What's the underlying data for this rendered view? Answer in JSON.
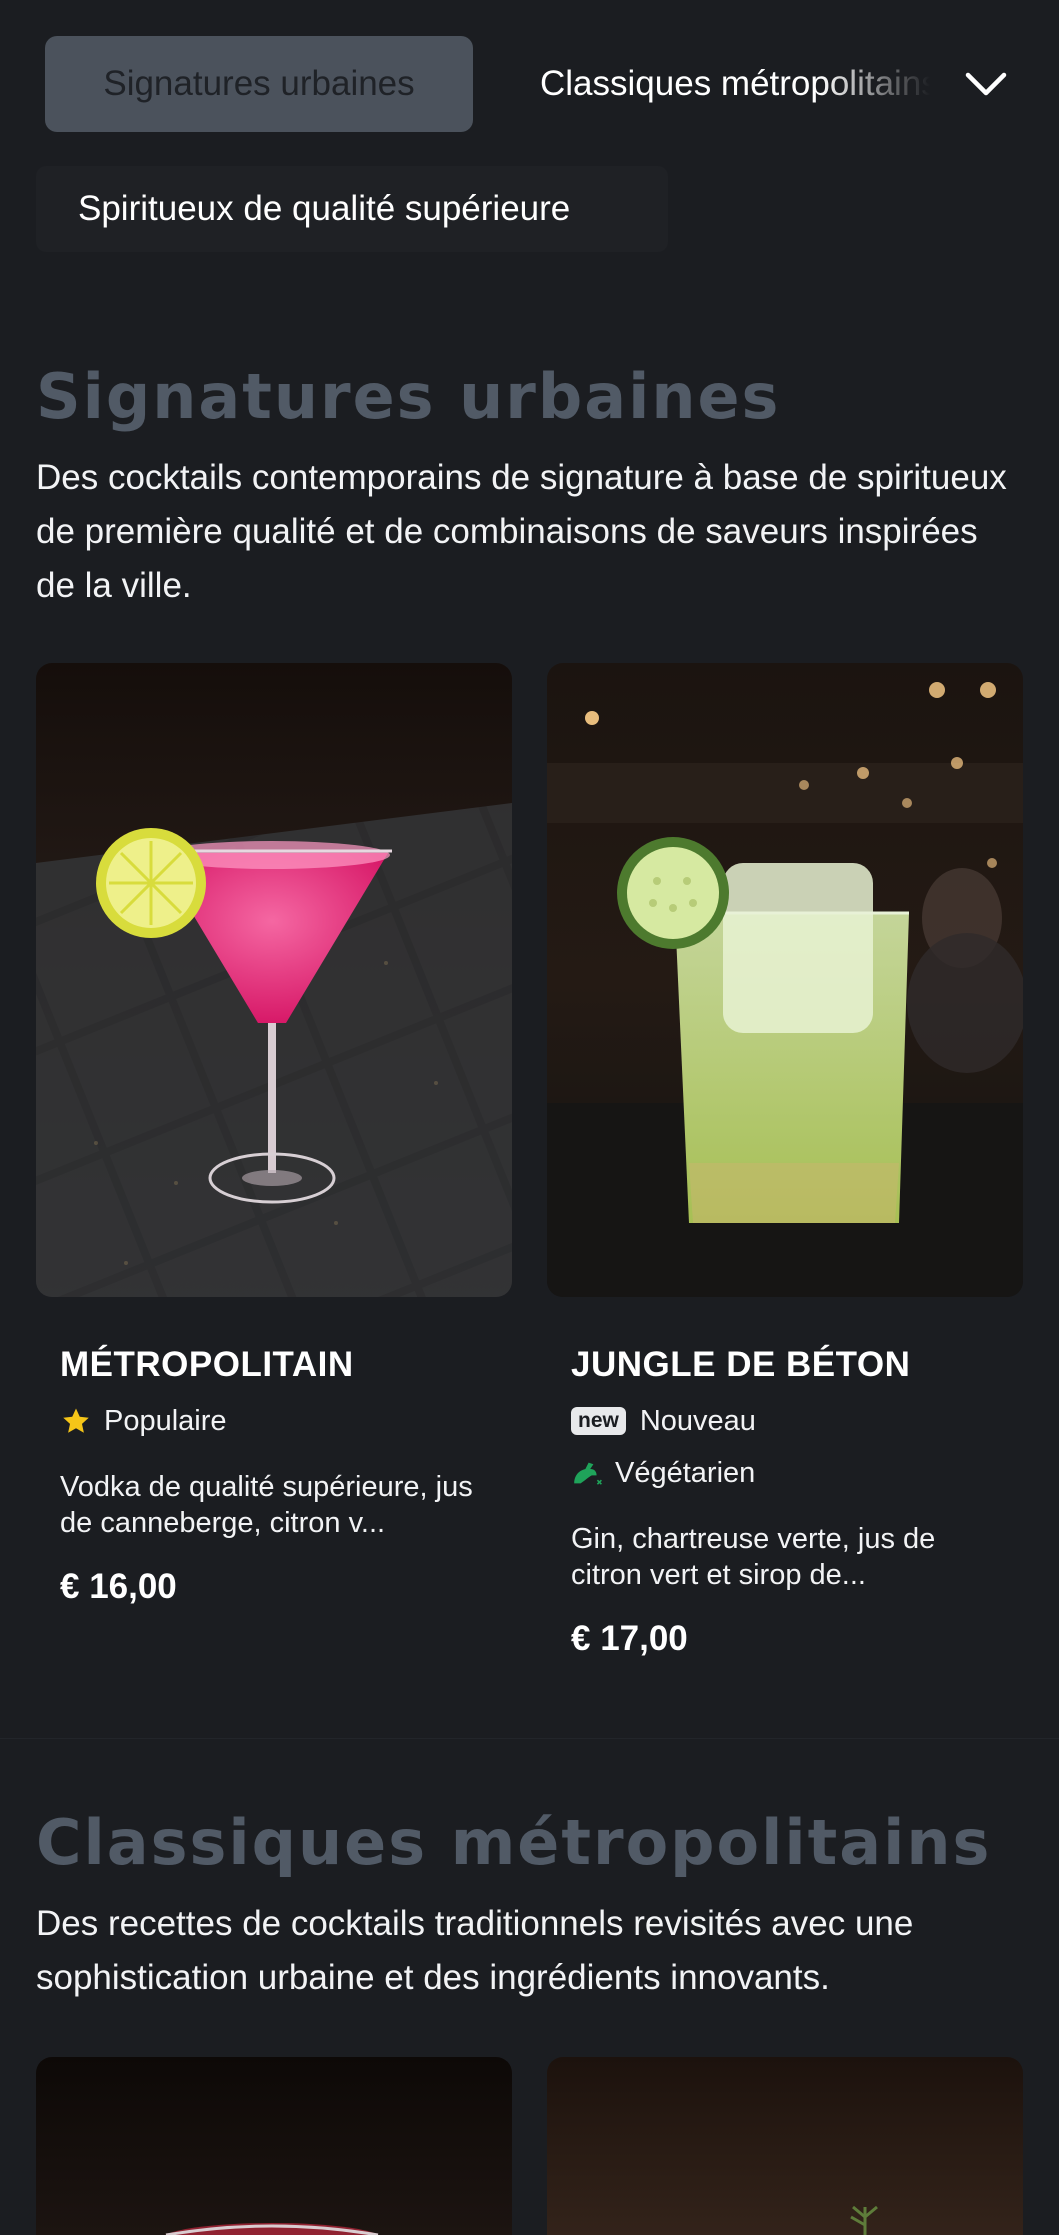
{
  "nav": {
    "active_tab": "Signatures urbaines",
    "tabs": [
      "Classiques métropolitains",
      "Spiritueux de qualité supérieure"
    ],
    "expand_icon": "chevron-down-icon"
  },
  "sections": [
    {
      "title": "Signatures urbaines",
      "description": "Des cocktails contemporains de signature à base de spiritueux de première qualité et de combinaisons de saveurs inspirées de la ville.",
      "items": [
        {
          "name": "MÉTROPOLITAIN",
          "tags": [
            {
              "icon": "star-icon",
              "label": "Populaire"
            }
          ],
          "description": "Vodka de qualité supérieure, jus de canneberge, citron v...",
          "price": "€ 16,00"
        },
        {
          "name": "JUNGLE DE BÉTON",
          "tags": [
            {
              "icon": "new-badge",
              "badge": "new",
              "label": "Nouveau"
            },
            {
              "icon": "vegetarian-icon",
              "label": "Végétarien"
            }
          ],
          "description": "Gin, chartreuse verte, jus de citron vert et sirop de...",
          "price": "€ 17,00"
        }
      ]
    },
    {
      "title": "Classiques métropolitains",
      "description": "Des recettes de cocktails traditionnels revisités avec une sophistication urbaine et des ingrédients innovants."
    }
  ],
  "colors": {
    "background": "#1b1d21",
    "active_tab_bg": "#4b525c",
    "section_title": "#515a66",
    "star": "#f5c518",
    "vegetarian": "#1fa35a"
  }
}
